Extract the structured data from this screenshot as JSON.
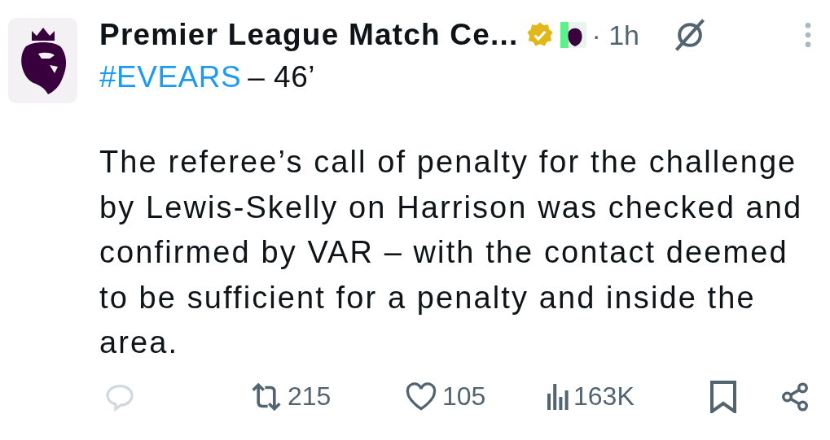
{
  "post": {
    "author": "Premier League Match Ce...",
    "verified": true,
    "time": "· 1h",
    "hashtag": "#EVEARS",
    "heading_rest": "– 46’",
    "body_lines": [
      "The referee’s call of penalty for the challenge",
      "by Lewis-Skelly on Harrison was checked and",
      "confirmed by VAR – with the contact deemed",
      "to be sufficient for a penalty and inside the",
      "area."
    ]
  },
  "actions": [
    {
      "kind": "reply",
      "disabled": true
    },
    {
      "kind": "repost",
      "count": "215"
    },
    {
      "kind": "like",
      "count": "105"
    },
    {
      "kind": "views",
      "count": "163K"
    },
    {
      "kind": "bookmark"
    },
    {
      "kind": "share"
    }
  ]
}
